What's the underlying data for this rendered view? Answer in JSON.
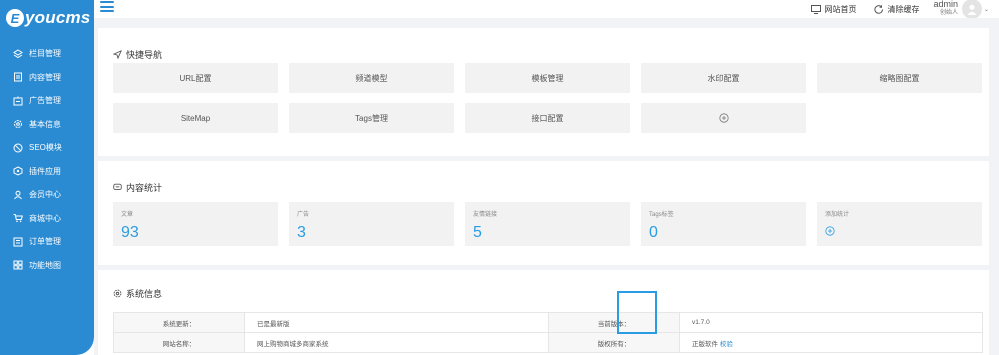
{
  "sidebar": {
    "logo_letter": "E",
    "logo_text": "youcms",
    "items": [
      {
        "label": "栏目管理",
        "icon": "layers-icon"
      },
      {
        "label": "内容管理",
        "icon": "document-icon"
      },
      {
        "label": "广告管理",
        "icon": "ad-icon"
      },
      {
        "label": "基本信息",
        "icon": "gear-icon"
      },
      {
        "label": "SEO模块",
        "icon": "seo-icon"
      },
      {
        "label": "插件应用",
        "icon": "plugin-icon"
      },
      {
        "label": "会员中心",
        "icon": "user-icon"
      },
      {
        "label": "商城中心",
        "icon": "cart-icon"
      },
      {
        "label": "订单管理",
        "icon": "order-icon"
      },
      {
        "label": "功能地图",
        "icon": "grid-icon"
      }
    ]
  },
  "topbar": {
    "site_home": "网站首页",
    "clear_cache": "清除缓存",
    "admin_name": "admin",
    "admin_role": "创始人"
  },
  "quicknav": {
    "title": "快捷导航",
    "buttons": [
      "URL配置",
      "频道模型",
      "模板管理",
      "水印配置",
      "缩略图配置",
      "SiteMap",
      "Tags管理",
      "接口配置"
    ]
  },
  "stats": {
    "title": "内容统计",
    "items": [
      {
        "label": "文章",
        "value": "93"
      },
      {
        "label": "广告",
        "value": "3"
      },
      {
        "label": "友情链接",
        "value": "5"
      },
      {
        "label": "Tags标签",
        "value": "0"
      }
    ],
    "add_label": "添加统计"
  },
  "sysinfo": {
    "title": "系统信息",
    "rows": [
      {
        "label1": "系统更新：",
        "value1": "已是最新版",
        "label2": "当前版本：",
        "value2": "v1.7.0"
      },
      {
        "label1": "网站名称：",
        "value1": "网上购物商城多商家系统",
        "label2": "版权所有：",
        "value2": "正版软件",
        "link": "校验"
      }
    ]
  },
  "colors": {
    "accent": "#2a8bd2",
    "stat_value": "#2a9de2"
  }
}
